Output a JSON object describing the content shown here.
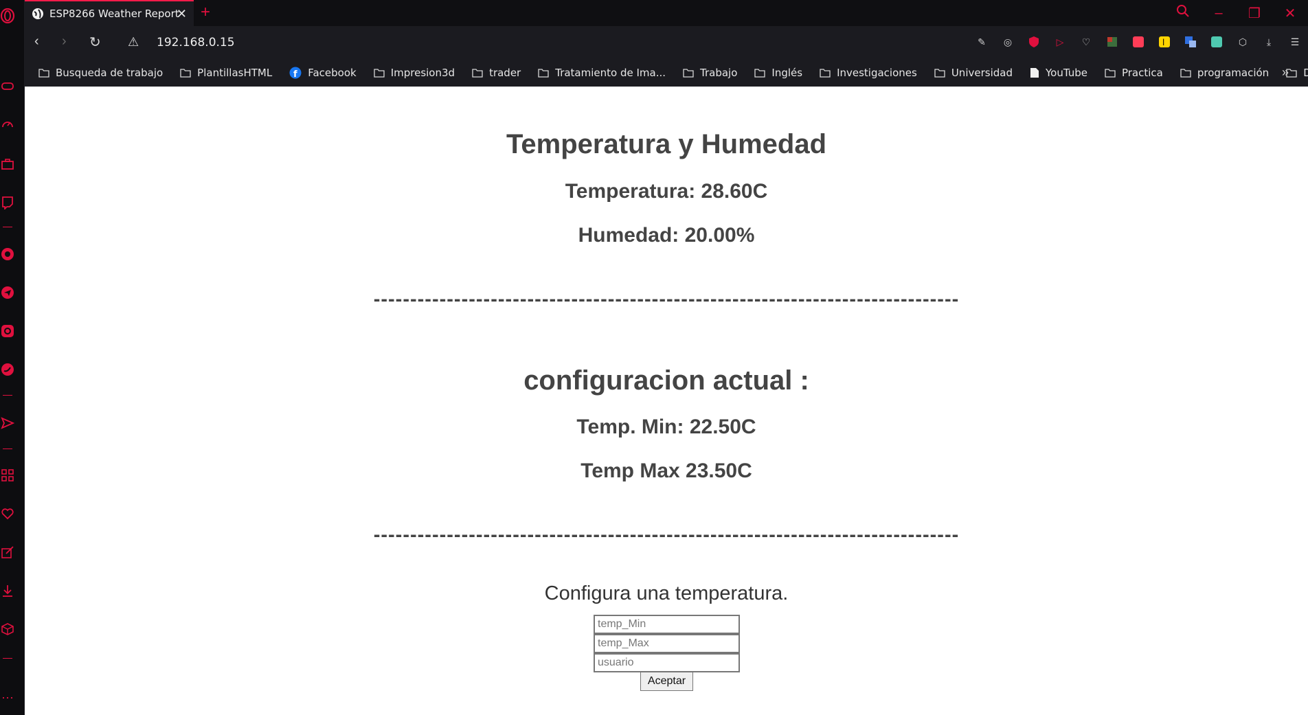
{
  "browser": {
    "tab_title": "ESP8266 Weather Report",
    "url": "192.168.0.15",
    "accent_color": "#ff1b4a",
    "bookmarks": [
      {
        "label": "Busqueda de trabajo",
        "icon": "folder-icon"
      },
      {
        "label": "PlantillasHTML",
        "icon": "folder-icon"
      },
      {
        "label": "Facebook",
        "icon": "facebook-icon"
      },
      {
        "label": "Impresion3d",
        "icon": "folder-icon"
      },
      {
        "label": "trader",
        "icon": "folder-icon"
      },
      {
        "label": "Tratamiento de Ima...",
        "icon": "folder-icon"
      },
      {
        "label": "Trabajo",
        "icon": "folder-icon"
      },
      {
        "label": "Inglés",
        "icon": "folder-icon"
      },
      {
        "label": "Investigaciones",
        "icon": "folder-icon"
      },
      {
        "label": "Universidad",
        "icon": "folder-icon"
      },
      {
        "label": "YouTube",
        "icon": "page-icon"
      },
      {
        "label": "Practica",
        "icon": "folder-icon"
      },
      {
        "label": "programación",
        "icon": "folder-icon"
      },
      {
        "label": "Diseño",
        "icon": "folder-icon"
      }
    ]
  },
  "page": {
    "title": "Temperatura y Humedad",
    "temperature": "Temperatura: 28.60C",
    "humidity": "Humedad: 20.00%",
    "divider": "--------------------------------------------------------------------------------",
    "config_title": "configuracion actual :",
    "temp_min": "Temp. Min: 22.50C",
    "temp_max": "Temp Max 23.50C",
    "form_title": "Configura una temperatura.",
    "placeholders": {
      "temp_min": "temp_Min",
      "temp_max": "temp_Max",
      "user": "usuario"
    },
    "submit_label": "Aceptar"
  }
}
